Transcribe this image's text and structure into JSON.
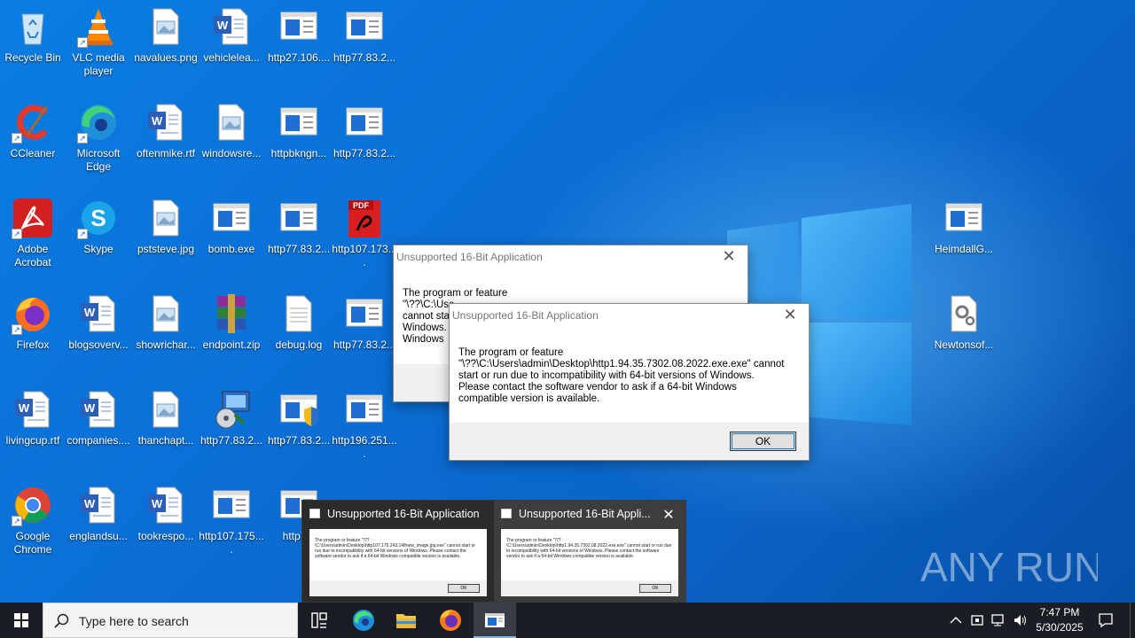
{
  "desktop_icons": [
    {
      "label": "Recycle Bin",
      "icon": "recycle-bin-icon"
    },
    {
      "label": "VLC media player",
      "icon": "vlc-icon"
    },
    {
      "label": "navalues.png",
      "icon": "image-file-icon"
    },
    {
      "label": "vehiclelea...",
      "icon": "word-doc-icon"
    },
    {
      "label": "http27.106....",
      "icon": "exe-window-icon"
    },
    {
      "label": "http77.83.2...",
      "icon": "exe-window-icon"
    },
    {
      "label": "CCleaner",
      "icon": "ccleaner-icon"
    },
    {
      "label": "Microsoft Edge",
      "icon": "edge-icon"
    },
    {
      "label": "oftenmike.rtf",
      "icon": "word-doc-icon"
    },
    {
      "label": "windowsre...",
      "icon": "image-file-icon"
    },
    {
      "label": "httpbkngn...",
      "icon": "exe-window-icon"
    },
    {
      "label": "http77.83.2...",
      "icon": "exe-window-icon"
    },
    {
      "label": "Adobe Acrobat",
      "icon": "acrobat-icon"
    },
    {
      "label": "Skype",
      "icon": "skype-icon"
    },
    {
      "label": "pststeve.jpg",
      "icon": "image-file-icon"
    },
    {
      "label": "bomb.exe",
      "icon": "exe-window-icon"
    },
    {
      "label": "http77.83.2...",
      "icon": "exe-window-icon"
    },
    {
      "label": "http107.173....",
      "icon": "pdf-file-icon"
    },
    {
      "label": "Firefox",
      "icon": "firefox-icon"
    },
    {
      "label": "blogsoverv...",
      "icon": "word-doc-icon"
    },
    {
      "label": "showrichar...",
      "icon": "image-file-icon"
    },
    {
      "label": "endpoint.zip",
      "icon": "winrar-icon"
    },
    {
      "label": "debug.log",
      "icon": "text-file-icon"
    },
    {
      "label": "http77.83.2...",
      "icon": "exe-window-icon"
    },
    {
      "label": "livingcup.rtf",
      "icon": "word-doc-icon"
    },
    {
      "label": "companies....",
      "icon": "word-doc-icon"
    },
    {
      "label": "thanchapt...",
      "icon": "image-file-icon"
    },
    {
      "label": "http77.83.2...",
      "icon": "installer-icon"
    },
    {
      "label": "http77.83.2...",
      "icon": "exe-shield-icon"
    },
    {
      "label": "http196.251....",
      "icon": "exe-window-icon"
    },
    {
      "label": "Google Chrome",
      "icon": "chrome-icon"
    },
    {
      "label": "englandsu...",
      "icon": "word-doc-icon"
    },
    {
      "label": "tookrespo...",
      "icon": "word-doc-icon"
    },
    {
      "label": "http107.175....",
      "icon": "exe-window-icon"
    },
    {
      "label": "http77.",
      "icon": "exe-window-icon"
    },
    {
      "label": "HeimdallG...",
      "icon": "exe-window-icon"
    },
    {
      "label": "Newtonsof...",
      "icon": "settings-file-icon"
    }
  ],
  "dialog_back": {
    "title": "Unsupported 16-Bit Application",
    "line1": "The program or feature",
    "line2": "\"\\??\\C:\\Use",
    "line3": "cannot sta",
    "line4": "Windows.",
    "line5": "Windows"
  },
  "dialog_front": {
    "title": "Unsupported 16-Bit Application",
    "message_line1": "The program or feature",
    "message_line2": "\"\\??\\C:\\Users\\admin\\Desktop\\http1.94.35.7302.08.2022.exe.exe\" cannot",
    "message_line3": "start or run due to incompatibility with 64-bit versions of Windows.",
    "message_line4": "Please contact the software vendor to ask if a 64-bit Windows",
    "message_line5": "compatible version is available.",
    "ok_label": "OK"
  },
  "preview": {
    "thumbs": [
      {
        "title": "Unsupported 16-Bit Application",
        "text": "The program or feature \"\\??\\C:\\Users\\admin\\Desktop\\http107.175.243.148new_image.jpg.exe\" cannot start or run due to incompatibility with 64-bit versions of Windows. Please contact the software vendor to ask if a 64-bit Windows compatible version is available.",
        "ok": "OK"
      },
      {
        "title": "Unsupported 16-Bit Appli...",
        "text": "The program or feature \"\\??\\C:\\Users\\admin\\Desktop\\http1.94.35.7302.08.2022.exe.exe\" cannot start or run due to incompatibility with 64-bit versions of Windows. Please contact the software vendor to ask if a 64-bit Windows compatible version is available.",
        "ok": "OK"
      }
    ],
    "close": "✕"
  },
  "taskbar": {
    "search_placeholder": "Type here to search",
    "time": "7:47 PM",
    "date": "5/30/2025"
  },
  "watermark": {
    "text": "ANY RUN"
  }
}
